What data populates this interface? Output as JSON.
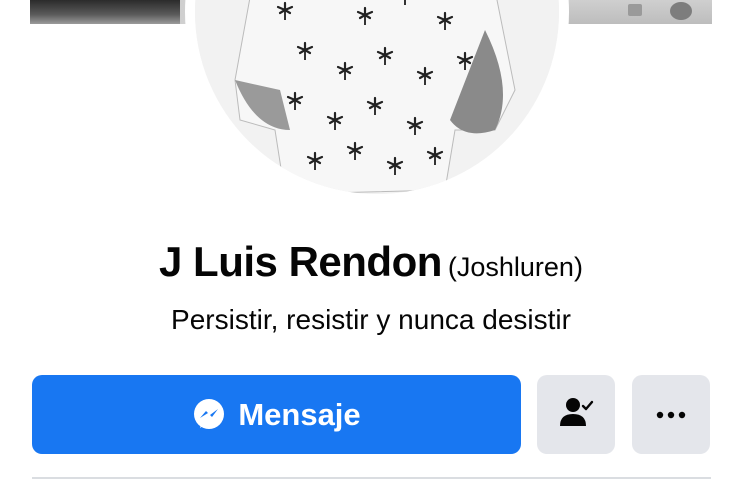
{
  "profile": {
    "name": "J Luis Rendon",
    "alternate_name": "(Joshluren)",
    "bio": "Persistir, resistir y nunca desistir"
  },
  "actions": {
    "message_label": "Mensaje",
    "friend_icon": "friend-check-icon",
    "more_icon": "more-options-icon"
  },
  "colors": {
    "primary": "#1877f2",
    "secondary_button": "#e4e6eb",
    "divider": "#dadde1"
  }
}
